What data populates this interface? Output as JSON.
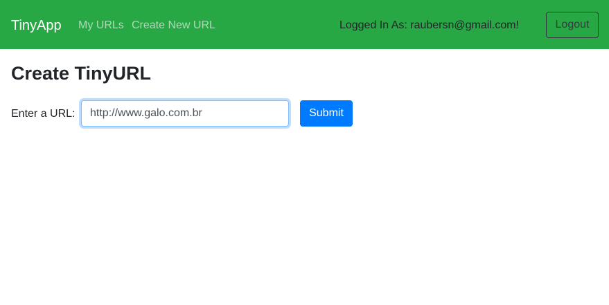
{
  "navbar": {
    "brand": "TinyApp",
    "links": [
      {
        "label": "My URLs"
      },
      {
        "label": "Create New URL"
      }
    ],
    "logged_in_text": "Logged In As: raubersn@gmail.com!",
    "logout_label": "Logout",
    "background_color": "#28a745"
  },
  "main": {
    "title": "Create TinyURL",
    "form": {
      "label": "Enter a URL:",
      "input_value": "http://www.galo.com.br",
      "submit_label": "Submit",
      "submit_color": "#007bff"
    }
  }
}
